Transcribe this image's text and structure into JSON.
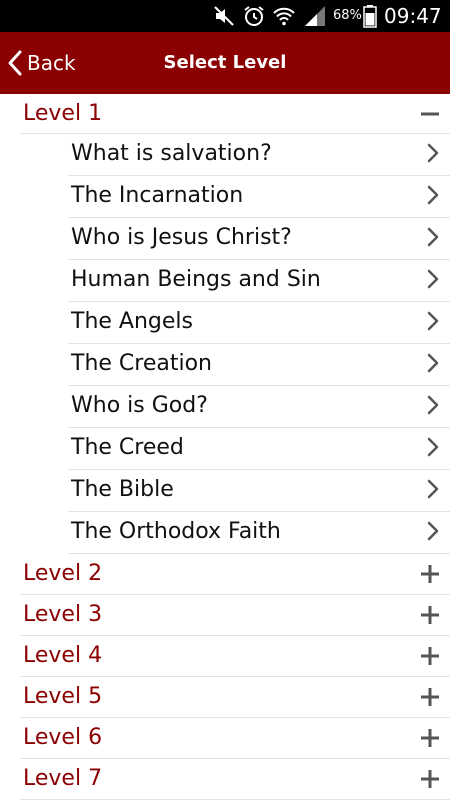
{
  "status_bar": {
    "battery_percent": "68%",
    "time": "09:47",
    "icons": [
      "mute-icon",
      "alarm-icon",
      "wifi-icon",
      "signal-icon",
      "battery-icon"
    ]
  },
  "app_bar": {
    "back_label": "Back",
    "title": "Select Level"
  },
  "colors": {
    "accent": "#8b0000",
    "text": "#111111",
    "divider": "#e2e2e2",
    "icon": "#555555"
  },
  "levels": [
    {
      "label": "Level 1",
      "expanded": true,
      "topics": [
        "What is salvation?",
        "The Incarnation",
        "Who is Jesus Christ?",
        "Human Beings and Sin",
        "The Angels",
        "The Creation",
        "Who is God?",
        "The Creed",
        "The Bible",
        "The Orthodox Faith"
      ]
    },
    {
      "label": "Level 2",
      "expanded": false
    },
    {
      "label": "Level 3",
      "expanded": false
    },
    {
      "label": "Level 4",
      "expanded": false
    },
    {
      "label": "Level 5",
      "expanded": false
    },
    {
      "label": "Level 6",
      "expanded": false
    },
    {
      "label": "Level 7",
      "expanded": false
    }
  ]
}
